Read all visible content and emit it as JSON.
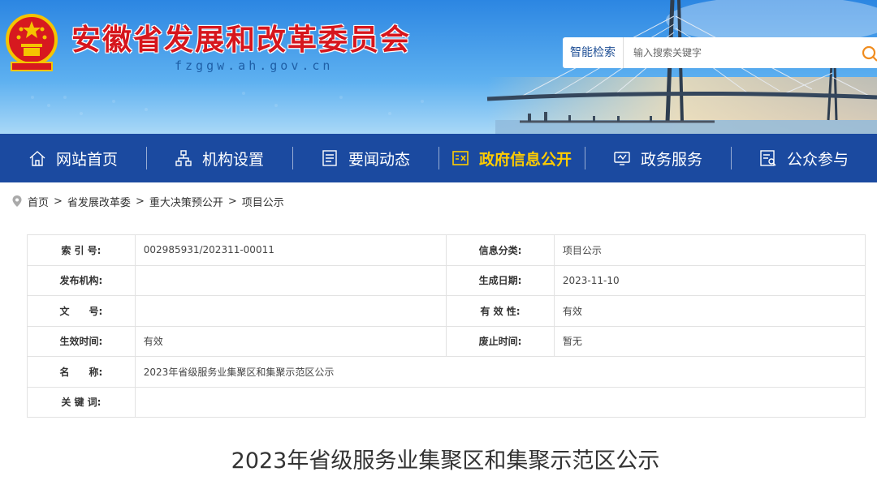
{
  "header": {
    "title": "安徽省发展和改革委员会",
    "domain": "fzggw.ah.gov.cn",
    "search_label": "智能检索",
    "search_placeholder": "输入搜索关键字"
  },
  "nav": {
    "items": [
      {
        "label": "网站首页",
        "icon": "home-icon"
      },
      {
        "label": "机构设置",
        "icon": "org-chart-icon"
      },
      {
        "label": "要闻动态",
        "icon": "news-icon"
      },
      {
        "label": "政府信息公开",
        "icon": "info-disclosure-icon",
        "active": true
      },
      {
        "label": "政务服务",
        "icon": "service-icon"
      },
      {
        "label": "公众参与",
        "icon": "participation-icon"
      }
    ]
  },
  "breadcrumb": [
    "首页",
    "省发展改革委",
    "重大决策预公开",
    "项目公示"
  ],
  "info": {
    "index_no_label": "索 引 号:",
    "index_no": "002985931/202311-00011",
    "category_label": "信息分类:",
    "category": "项目公示",
    "publisher_label": "发布机构:",
    "publisher": "",
    "created_label": "生成日期:",
    "created": "2023-11-10",
    "doc_no_label": "文　　号:",
    "doc_no": "",
    "validity_label": "有 效 性:",
    "validity": "有效",
    "effective_label": "生效时间:",
    "effective": "有效",
    "repeal_label": "废止时间:",
    "repeal": "暂无",
    "name_label": "名　　称:",
    "name": "2023年省级服务业集聚区和集聚示范区公示",
    "keywords_label": "关 键 词:",
    "keywords": ""
  },
  "article": {
    "title": "2023年省级服务业集聚区和集聚示范区公示"
  },
  "colors": {
    "nav_bg": "#1b4aa0",
    "nav_active": "#ffcc00",
    "title_red": "#d6161d"
  }
}
